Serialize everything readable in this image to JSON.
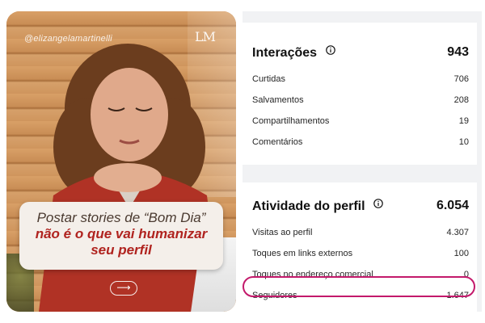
{
  "post": {
    "handle": "@elizangelamartinelli",
    "logo_text": "LM",
    "caption": {
      "line1": "Postar stories de “Bom Dia”",
      "line2": "não é o que vai humanizar",
      "line3": "seu perfil"
    },
    "next_arrow": "⟶",
    "accent_color": "#b0231f"
  },
  "interactions": {
    "title": "Interações",
    "total": "943",
    "rows": [
      {
        "label": "Curtidas",
        "value": "706"
      },
      {
        "label": "Salvamentos",
        "value": "208"
      },
      {
        "label": "Compartilhamentos",
        "value": "19"
      },
      {
        "label": "Comentários",
        "value": "10"
      }
    ]
  },
  "profile_activity": {
    "title": "Atividade do perfil",
    "total": "6.054",
    "rows": [
      {
        "label": "Visitas ao perfil",
        "value": "4.307"
      },
      {
        "label": "Toques em links externos",
        "value": "100"
      },
      {
        "label": "Toques no endereço comercial",
        "value": "0"
      },
      {
        "label": "Seguidores",
        "value": "1.647"
      }
    ],
    "highlight_color": "#c3196b"
  },
  "icons": {
    "info": "info-icon",
    "next": "arrow-right-icon"
  }
}
